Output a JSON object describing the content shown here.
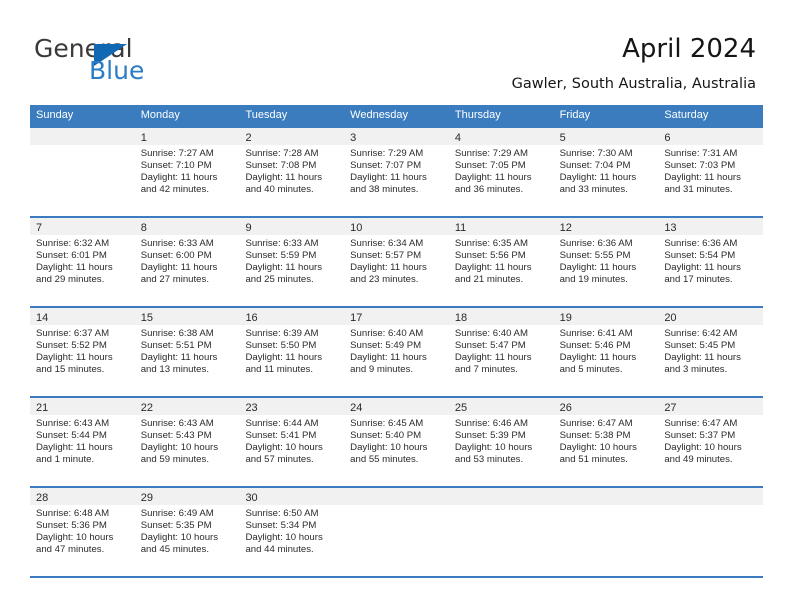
{
  "brand": {
    "name_top": "General",
    "name_bottom": "Blue",
    "accent_color": "#1268b3",
    "blue_text_color": "#2b7cc4"
  },
  "header": {
    "title": "April 2024",
    "subtitle": "Gawler, South Australia, Australia"
  },
  "calendar": {
    "header_color": "#3a7cbe",
    "band_color": "#f1f1f1",
    "weekdays": [
      "Sunday",
      "Monday",
      "Tuesday",
      "Wednesday",
      "Thursday",
      "Friday",
      "Saturday"
    ],
    "weeks": [
      [
        {
          "empty": true
        },
        {
          "day": "1",
          "sunrise": "Sunrise: 7:27 AM",
          "sunset": "Sunset: 7:10 PM",
          "daylight_line1": "Daylight: 11 hours",
          "daylight_line2": "and 42 minutes."
        },
        {
          "day": "2",
          "sunrise": "Sunrise: 7:28 AM",
          "sunset": "Sunset: 7:08 PM",
          "daylight_line1": "Daylight: 11 hours",
          "daylight_line2": "and 40 minutes."
        },
        {
          "day": "3",
          "sunrise": "Sunrise: 7:29 AM",
          "sunset": "Sunset: 7:07 PM",
          "daylight_line1": "Daylight: 11 hours",
          "daylight_line2": "and 38 minutes."
        },
        {
          "day": "4",
          "sunrise": "Sunrise: 7:29 AM",
          "sunset": "Sunset: 7:05 PM",
          "daylight_line1": "Daylight: 11 hours",
          "daylight_line2": "and 36 minutes."
        },
        {
          "day": "5",
          "sunrise": "Sunrise: 7:30 AM",
          "sunset": "Sunset: 7:04 PM",
          "daylight_line1": "Daylight: 11 hours",
          "daylight_line2": "and 33 minutes."
        },
        {
          "day": "6",
          "sunrise": "Sunrise: 7:31 AM",
          "sunset": "Sunset: 7:03 PM",
          "daylight_line1": "Daylight: 11 hours",
          "daylight_line2": "and 31 minutes."
        }
      ],
      [
        {
          "day": "7",
          "sunrise": "Sunrise: 6:32 AM",
          "sunset": "Sunset: 6:01 PM",
          "daylight_line1": "Daylight: 11 hours",
          "daylight_line2": "and 29 minutes."
        },
        {
          "day": "8",
          "sunrise": "Sunrise: 6:33 AM",
          "sunset": "Sunset: 6:00 PM",
          "daylight_line1": "Daylight: 11 hours",
          "daylight_line2": "and 27 minutes."
        },
        {
          "day": "9",
          "sunrise": "Sunrise: 6:33 AM",
          "sunset": "Sunset: 5:59 PM",
          "daylight_line1": "Daylight: 11 hours",
          "daylight_line2": "and 25 minutes."
        },
        {
          "day": "10",
          "sunrise": "Sunrise: 6:34 AM",
          "sunset": "Sunset: 5:57 PM",
          "daylight_line1": "Daylight: 11 hours",
          "daylight_line2": "and 23 minutes."
        },
        {
          "day": "11",
          "sunrise": "Sunrise: 6:35 AM",
          "sunset": "Sunset: 5:56 PM",
          "daylight_line1": "Daylight: 11 hours",
          "daylight_line2": "and 21 minutes."
        },
        {
          "day": "12",
          "sunrise": "Sunrise: 6:36 AM",
          "sunset": "Sunset: 5:55 PM",
          "daylight_line1": "Daylight: 11 hours",
          "daylight_line2": "and 19 minutes."
        },
        {
          "day": "13",
          "sunrise": "Sunrise: 6:36 AM",
          "sunset": "Sunset: 5:54 PM",
          "daylight_line1": "Daylight: 11 hours",
          "daylight_line2": "and 17 minutes."
        }
      ],
      [
        {
          "day": "14",
          "sunrise": "Sunrise: 6:37 AM",
          "sunset": "Sunset: 5:52 PM",
          "daylight_line1": "Daylight: 11 hours",
          "daylight_line2": "and 15 minutes."
        },
        {
          "day": "15",
          "sunrise": "Sunrise: 6:38 AM",
          "sunset": "Sunset: 5:51 PM",
          "daylight_line1": "Daylight: 11 hours",
          "daylight_line2": "and 13 minutes."
        },
        {
          "day": "16",
          "sunrise": "Sunrise: 6:39 AM",
          "sunset": "Sunset: 5:50 PM",
          "daylight_line1": "Daylight: 11 hours",
          "daylight_line2": "and 11 minutes."
        },
        {
          "day": "17",
          "sunrise": "Sunrise: 6:40 AM",
          "sunset": "Sunset: 5:49 PM",
          "daylight_line1": "Daylight: 11 hours",
          "daylight_line2": "and 9 minutes."
        },
        {
          "day": "18",
          "sunrise": "Sunrise: 6:40 AM",
          "sunset": "Sunset: 5:47 PM",
          "daylight_line1": "Daylight: 11 hours",
          "daylight_line2": "and 7 minutes."
        },
        {
          "day": "19",
          "sunrise": "Sunrise: 6:41 AM",
          "sunset": "Sunset: 5:46 PM",
          "daylight_line1": "Daylight: 11 hours",
          "daylight_line2": "and 5 minutes."
        },
        {
          "day": "20",
          "sunrise": "Sunrise: 6:42 AM",
          "sunset": "Sunset: 5:45 PM",
          "daylight_line1": "Daylight: 11 hours",
          "daylight_line2": "and 3 minutes."
        }
      ],
      [
        {
          "day": "21",
          "sunrise": "Sunrise: 6:43 AM",
          "sunset": "Sunset: 5:44 PM",
          "daylight_line1": "Daylight: 11 hours",
          "daylight_line2": "and 1 minute."
        },
        {
          "day": "22",
          "sunrise": "Sunrise: 6:43 AM",
          "sunset": "Sunset: 5:43 PM",
          "daylight_line1": "Daylight: 10 hours",
          "daylight_line2": "and 59 minutes."
        },
        {
          "day": "23",
          "sunrise": "Sunrise: 6:44 AM",
          "sunset": "Sunset: 5:41 PM",
          "daylight_line1": "Daylight: 10 hours",
          "daylight_line2": "and 57 minutes."
        },
        {
          "day": "24",
          "sunrise": "Sunrise: 6:45 AM",
          "sunset": "Sunset: 5:40 PM",
          "daylight_line1": "Daylight: 10 hours",
          "daylight_line2": "and 55 minutes."
        },
        {
          "day": "25",
          "sunrise": "Sunrise: 6:46 AM",
          "sunset": "Sunset: 5:39 PM",
          "daylight_line1": "Daylight: 10 hours",
          "daylight_line2": "and 53 minutes."
        },
        {
          "day": "26",
          "sunrise": "Sunrise: 6:47 AM",
          "sunset": "Sunset: 5:38 PM",
          "daylight_line1": "Daylight: 10 hours",
          "daylight_line2": "and 51 minutes."
        },
        {
          "day": "27",
          "sunrise": "Sunrise: 6:47 AM",
          "sunset": "Sunset: 5:37 PM",
          "daylight_line1": "Daylight: 10 hours",
          "daylight_line2": "and 49 minutes."
        }
      ],
      [
        {
          "day": "28",
          "sunrise": "Sunrise: 6:48 AM",
          "sunset": "Sunset: 5:36 PM",
          "daylight_line1": "Daylight: 10 hours",
          "daylight_line2": "and 47 minutes."
        },
        {
          "day": "29",
          "sunrise": "Sunrise: 6:49 AM",
          "sunset": "Sunset: 5:35 PM",
          "daylight_line1": "Daylight: 10 hours",
          "daylight_line2": "and 45 minutes."
        },
        {
          "day": "30",
          "sunrise": "Sunrise: 6:50 AM",
          "sunset": "Sunset: 5:34 PM",
          "daylight_line1": "Daylight: 10 hours",
          "daylight_line2": "and 44 minutes."
        },
        {
          "empty": true
        },
        {
          "empty": true
        },
        {
          "empty": true
        },
        {
          "empty": true
        }
      ]
    ]
  }
}
